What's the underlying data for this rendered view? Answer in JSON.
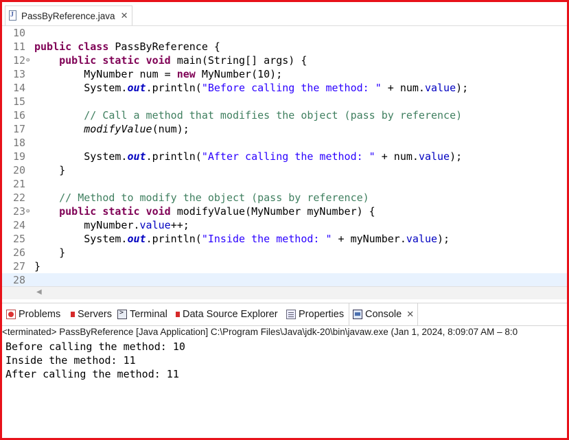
{
  "editor_tab": {
    "title": "PassByReference.java",
    "close": "✕"
  },
  "code_lines": [
    {
      "n": "10",
      "html": ""
    },
    {
      "n": "11",
      "html": "<span class=\"kw\">public</span> <span class=\"kw\">class</span> PassByReference {"
    },
    {
      "n": "12",
      "fold": true,
      "html": "    <span class=\"kw\">public</span> <span class=\"kw\">static</span> <span class=\"kw\">void</span> main(String[] args) {"
    },
    {
      "n": "13",
      "html": "        MyNumber num = <span class=\"kw\">new</span> MyNumber(10);"
    },
    {
      "n": "14",
      "html": "        System.<span class=\"sfld\">out</span>.println(<span class=\"str\">\"Before calling the method: \"</span> + num.<span class=\"fld\">value</span>);"
    },
    {
      "n": "15",
      "html": ""
    },
    {
      "n": "16",
      "html": "        <span class=\"cm\">// Call a method that modifies the object (pass by reference)</span>"
    },
    {
      "n": "17",
      "html": "        <span class=\"mitalic\">modifyValue</span>(num);"
    },
    {
      "n": "18",
      "html": ""
    },
    {
      "n": "19",
      "html": "        System.<span class=\"sfld\">out</span>.println(<span class=\"str\">\"After calling the method: \"</span> + num.<span class=\"fld\">value</span>);"
    },
    {
      "n": "20",
      "html": "    }"
    },
    {
      "n": "21",
      "html": ""
    },
    {
      "n": "22",
      "html": "    <span class=\"cm\">// Method to modify the object (pass by reference)</span>"
    },
    {
      "n": "23",
      "fold": true,
      "html": "    <span class=\"kw\">public</span> <span class=\"kw\">static</span> <span class=\"kw\">void</span> modifyValue(MyNumber myNumber) {"
    },
    {
      "n": "24",
      "html": "        myNumber.<span class=\"fld\">value</span>++;"
    },
    {
      "n": "25",
      "html": "        System.<span class=\"sfld\">out</span>.println(<span class=\"str\">\"Inside the method: \"</span> + myNumber.<span class=\"fld\">value</span>);"
    },
    {
      "n": "26",
      "html": "    }"
    },
    {
      "n": "27",
      "html": "}"
    },
    {
      "n": "28",
      "html": "",
      "current": true
    }
  ],
  "panel_tabs": {
    "problems": "Problems",
    "servers": "Servers",
    "terminal": "Terminal",
    "data_source": "Data Source Explorer",
    "properties": "Properties",
    "console": "Console",
    "console_close": "✕"
  },
  "console": {
    "header": "<terminated> PassByReference [Java Application] C:\\Program Files\\Java\\jdk-20\\bin\\javaw.exe  (Jan 1, 2024, 8:09:07 AM – 8:0",
    "output": [
      "Before calling the method: 10",
      "Inside the method: 11",
      "After calling the method: 11"
    ]
  }
}
